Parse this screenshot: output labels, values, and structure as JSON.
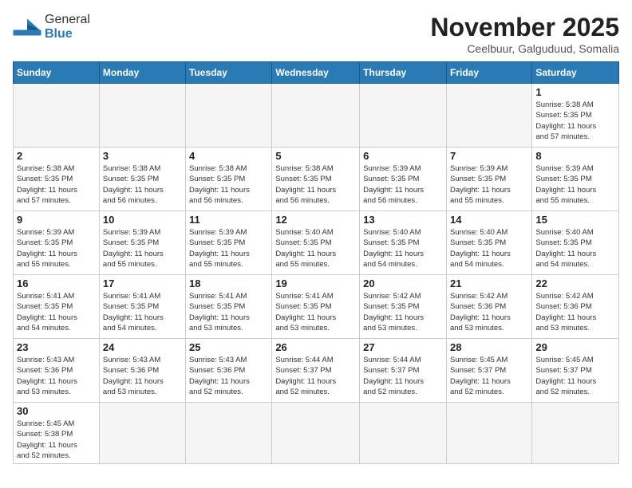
{
  "header": {
    "logo_line1": "General",
    "logo_line2": "Blue",
    "month_title": "November 2025",
    "subtitle": "Ceelbuur, Galguduud, Somalia"
  },
  "weekdays": [
    "Sunday",
    "Monday",
    "Tuesday",
    "Wednesday",
    "Thursday",
    "Friday",
    "Saturday"
  ],
  "weeks": [
    [
      {
        "day": "",
        "info": ""
      },
      {
        "day": "",
        "info": ""
      },
      {
        "day": "",
        "info": ""
      },
      {
        "day": "",
        "info": ""
      },
      {
        "day": "",
        "info": ""
      },
      {
        "day": "",
        "info": ""
      },
      {
        "day": "1",
        "info": "Sunrise: 5:38 AM\nSunset: 5:35 PM\nDaylight: 11 hours\nand 57 minutes."
      }
    ],
    [
      {
        "day": "2",
        "info": "Sunrise: 5:38 AM\nSunset: 5:35 PM\nDaylight: 11 hours\nand 57 minutes."
      },
      {
        "day": "3",
        "info": "Sunrise: 5:38 AM\nSunset: 5:35 PM\nDaylight: 11 hours\nand 56 minutes."
      },
      {
        "day": "4",
        "info": "Sunrise: 5:38 AM\nSunset: 5:35 PM\nDaylight: 11 hours\nand 56 minutes."
      },
      {
        "day": "5",
        "info": "Sunrise: 5:38 AM\nSunset: 5:35 PM\nDaylight: 11 hours\nand 56 minutes."
      },
      {
        "day": "6",
        "info": "Sunrise: 5:39 AM\nSunset: 5:35 PM\nDaylight: 11 hours\nand 56 minutes."
      },
      {
        "day": "7",
        "info": "Sunrise: 5:39 AM\nSunset: 5:35 PM\nDaylight: 11 hours\nand 55 minutes."
      },
      {
        "day": "8",
        "info": "Sunrise: 5:39 AM\nSunset: 5:35 PM\nDaylight: 11 hours\nand 55 minutes."
      }
    ],
    [
      {
        "day": "9",
        "info": "Sunrise: 5:39 AM\nSunset: 5:35 PM\nDaylight: 11 hours\nand 55 minutes."
      },
      {
        "day": "10",
        "info": "Sunrise: 5:39 AM\nSunset: 5:35 PM\nDaylight: 11 hours\nand 55 minutes."
      },
      {
        "day": "11",
        "info": "Sunrise: 5:39 AM\nSunset: 5:35 PM\nDaylight: 11 hours\nand 55 minutes."
      },
      {
        "day": "12",
        "info": "Sunrise: 5:40 AM\nSunset: 5:35 PM\nDaylight: 11 hours\nand 55 minutes."
      },
      {
        "day": "13",
        "info": "Sunrise: 5:40 AM\nSunset: 5:35 PM\nDaylight: 11 hours\nand 54 minutes."
      },
      {
        "day": "14",
        "info": "Sunrise: 5:40 AM\nSunset: 5:35 PM\nDaylight: 11 hours\nand 54 minutes."
      },
      {
        "day": "15",
        "info": "Sunrise: 5:40 AM\nSunset: 5:35 PM\nDaylight: 11 hours\nand 54 minutes."
      }
    ],
    [
      {
        "day": "16",
        "info": "Sunrise: 5:41 AM\nSunset: 5:35 PM\nDaylight: 11 hours\nand 54 minutes."
      },
      {
        "day": "17",
        "info": "Sunrise: 5:41 AM\nSunset: 5:35 PM\nDaylight: 11 hours\nand 54 minutes."
      },
      {
        "day": "18",
        "info": "Sunrise: 5:41 AM\nSunset: 5:35 PM\nDaylight: 11 hours\nand 53 minutes."
      },
      {
        "day": "19",
        "info": "Sunrise: 5:41 AM\nSunset: 5:35 PM\nDaylight: 11 hours\nand 53 minutes."
      },
      {
        "day": "20",
        "info": "Sunrise: 5:42 AM\nSunset: 5:35 PM\nDaylight: 11 hours\nand 53 minutes."
      },
      {
        "day": "21",
        "info": "Sunrise: 5:42 AM\nSunset: 5:36 PM\nDaylight: 11 hours\nand 53 minutes."
      },
      {
        "day": "22",
        "info": "Sunrise: 5:42 AM\nSunset: 5:36 PM\nDaylight: 11 hours\nand 53 minutes."
      }
    ],
    [
      {
        "day": "23",
        "info": "Sunrise: 5:43 AM\nSunset: 5:36 PM\nDaylight: 11 hours\nand 53 minutes."
      },
      {
        "day": "24",
        "info": "Sunrise: 5:43 AM\nSunset: 5:36 PM\nDaylight: 11 hours\nand 53 minutes."
      },
      {
        "day": "25",
        "info": "Sunrise: 5:43 AM\nSunset: 5:36 PM\nDaylight: 11 hours\nand 52 minutes."
      },
      {
        "day": "26",
        "info": "Sunrise: 5:44 AM\nSunset: 5:37 PM\nDaylight: 11 hours\nand 52 minutes."
      },
      {
        "day": "27",
        "info": "Sunrise: 5:44 AM\nSunset: 5:37 PM\nDaylight: 11 hours\nand 52 minutes."
      },
      {
        "day": "28",
        "info": "Sunrise: 5:45 AM\nSunset: 5:37 PM\nDaylight: 11 hours\nand 52 minutes."
      },
      {
        "day": "29",
        "info": "Sunrise: 5:45 AM\nSunset: 5:37 PM\nDaylight: 11 hours\nand 52 minutes."
      }
    ],
    [
      {
        "day": "30",
        "info": "Sunrise: 5:45 AM\nSunset: 5:38 PM\nDaylight: 11 hours\nand 52 minutes."
      },
      {
        "day": "",
        "info": ""
      },
      {
        "day": "",
        "info": ""
      },
      {
        "day": "",
        "info": ""
      },
      {
        "day": "",
        "info": ""
      },
      {
        "day": "",
        "info": ""
      },
      {
        "day": "",
        "info": ""
      }
    ]
  ]
}
